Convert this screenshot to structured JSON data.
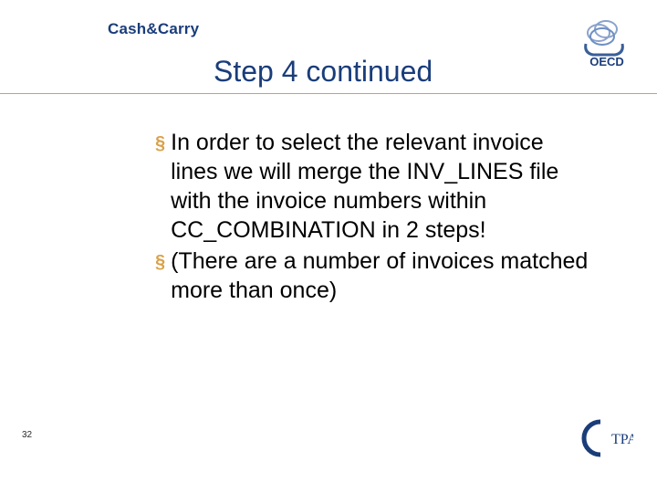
{
  "header": {
    "brand": "Cash&Carry",
    "subtitle": "Step 4 continued"
  },
  "bullets": [
    {
      "text": "In order to select the relevant invoice lines we will merge the INV_LINES file with the invoice numbers within CC_COMBINATION in 2 steps!"
    },
    {
      "text": "(There are a number of invoices matched more than once)"
    }
  ],
  "page_number": "32",
  "logos": {
    "top_right": "OECD",
    "bottom_right": "CTPA"
  },
  "colors": {
    "title": "#1a3d7a",
    "accent": "#d9a14a"
  }
}
